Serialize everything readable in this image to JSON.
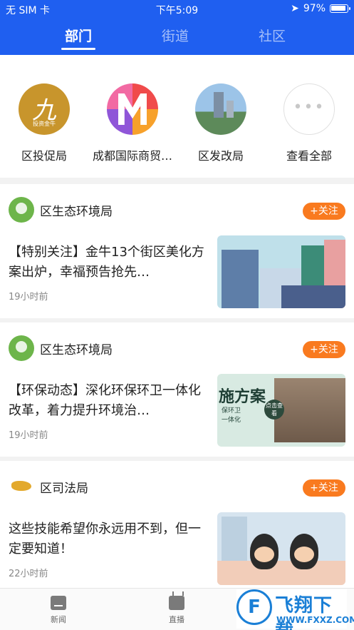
{
  "status": {
    "carrier": "无 SIM 卡",
    "time": "下午5:09",
    "battery": "97%"
  },
  "tabs": [
    {
      "label": "部门",
      "active": true
    },
    {
      "label": "街道",
      "active": false
    },
    {
      "label": "社区",
      "active": false
    }
  ],
  "departments": [
    {
      "label": "区投促局",
      "icon": "department-logo-gold",
      "logo_text": "九",
      "logo_caption": "投资金牛"
    },
    {
      "label": "成都国际商贸…",
      "icon": "department-logo-m"
    },
    {
      "label": "区发改局",
      "icon": "department-logo-city"
    },
    {
      "label": "查看全部",
      "icon": "more-dots-icon",
      "glyph": "•••"
    }
  ],
  "feed": [
    {
      "source": "区生态环境局",
      "follow": "+关注",
      "title": "【特别关注】金牛13个街区美化方案出炉，幸福预告抢先…",
      "time": "19小时前"
    },
    {
      "source": "区生态环境局",
      "follow": "+关注",
      "title": "【环保动态】深化环保环卫一体化改革，着力提升环境治…",
      "time": "19小时前",
      "thumb_text": "施方案",
      "thumb_small": "保环卫\n一体化",
      "thumb_badge": "点击查看"
    },
    {
      "source": "区司法局",
      "follow": "+关注",
      "title": "这些技能希望你永远用不到，但一定要知道！",
      "time": "22小时前"
    }
  ],
  "bottom_tabs": [
    {
      "label": "新闻",
      "icon": "news-icon"
    },
    {
      "label": "直播",
      "icon": "tv-icon"
    }
  ],
  "watermark": {
    "title": "飞翔下载",
    "url": "WWW.FXXZ.COM"
  },
  "colors": {
    "header": "#1f5ff0",
    "follow": "#f97a1f"
  }
}
